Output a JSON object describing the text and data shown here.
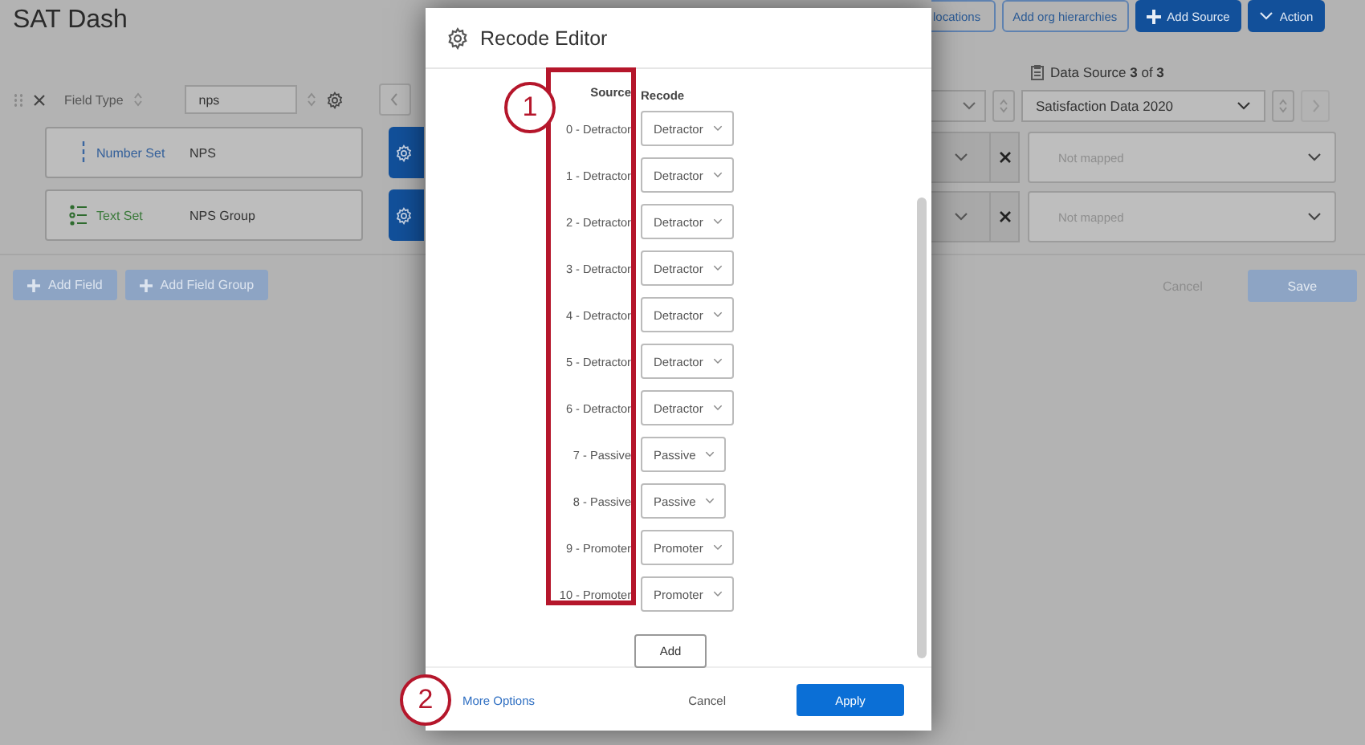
{
  "page": {
    "title": "SAT Dash"
  },
  "header_buttons": [
    {
      "label": "locations",
      "kind": "outline"
    },
    {
      "label": "Add org hierarchies",
      "kind": "outline"
    },
    {
      "label": "Add Source",
      "kind": "add"
    },
    {
      "label": "Action",
      "kind": "menu"
    }
  ],
  "field_header": {
    "label": "Field Type",
    "search_value": "nps"
  },
  "data_source": {
    "label": "Data Source **3** of **3**",
    "selected_source": "Satisfaction Data 2020"
  },
  "fields": [
    {
      "kind": "number",
      "type_label": "Number Set",
      "name": "NPS",
      "mapping": "Not mapped"
    },
    {
      "kind": "text",
      "type_label": "Text Set",
      "name": "NPS Group",
      "mapping": "Not mapped"
    }
  ],
  "footer": {
    "add_buttons": [
      "Add Field",
      "Add Field Group"
    ],
    "cancel": "Cancel",
    "save": {
      "label": "Save",
      "disabled": true
    }
  },
  "modal": {
    "title": "Recode Editor",
    "columns": [
      "Source",
      "Recode"
    ],
    "rows": [
      {
        "source": "0 - Detractor",
        "recode": "Detractor"
      },
      {
        "source": "1 - Detractor",
        "recode": "Detractor"
      },
      {
        "source": "2 - Detractor",
        "recode": "Detractor"
      },
      {
        "source": "3 - Detractor",
        "recode": "Detractor"
      },
      {
        "source": "4 - Detractor",
        "recode": "Detractor"
      },
      {
        "source": "5 - Detractor",
        "recode": "Detractor"
      },
      {
        "source": "6 - Detractor",
        "recode": "Detractor"
      },
      {
        "source": "7 - Passive",
        "recode": "Passive"
      },
      {
        "source": "8 - Passive",
        "recode": "Passive"
      },
      {
        "source": "9 - Promoter",
        "recode": "Promoter"
      },
      {
        "source": "10 - Promoter",
        "recode": "Promoter"
      }
    ],
    "add_button": "Add",
    "more_options": "More Options",
    "cancel": "Cancel",
    "apply": "Apply"
  },
  "callouts": [
    {
      "label": "1"
    },
    {
      "label": "2"
    }
  ]
}
